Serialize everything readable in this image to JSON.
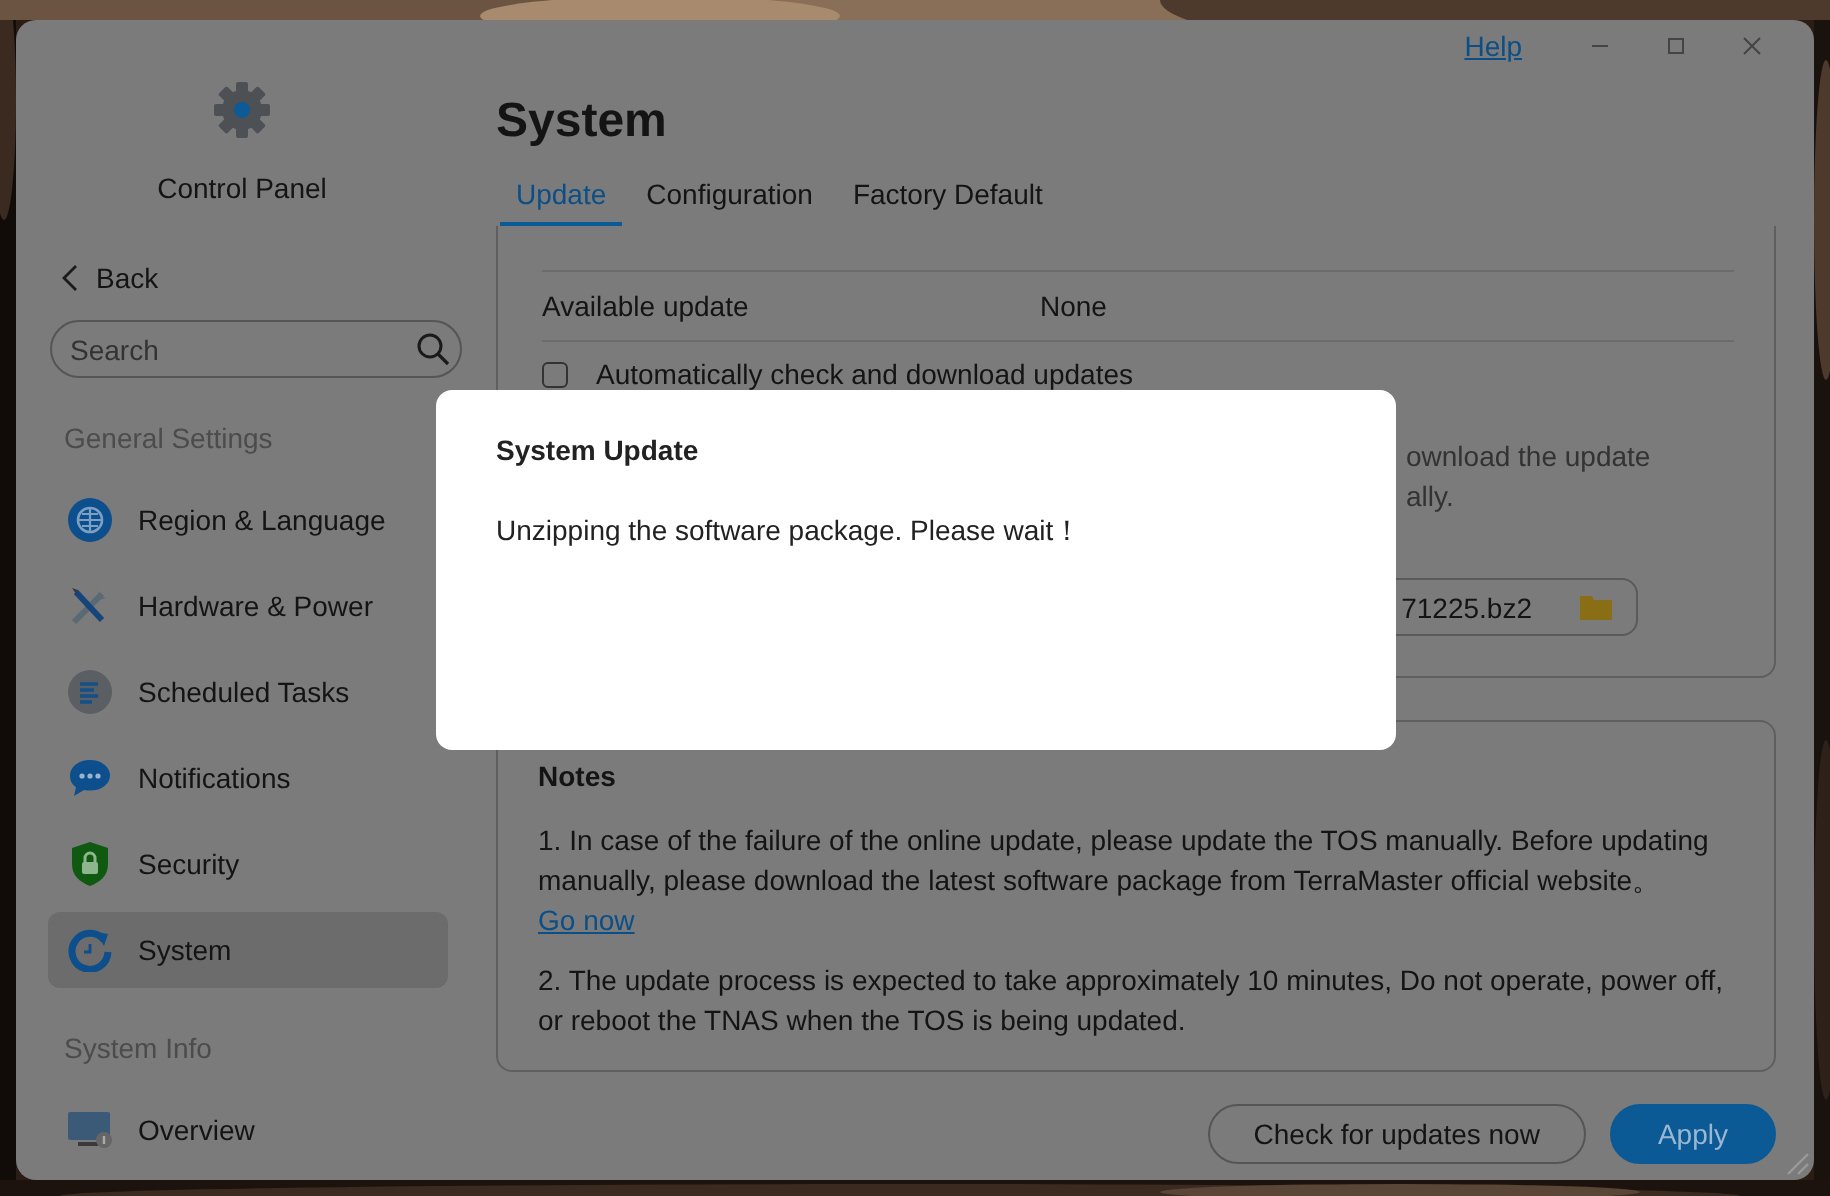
{
  "window": {
    "help": "Help"
  },
  "sidebar": {
    "title": "Control Panel",
    "back": "Back",
    "search": {
      "placeholder": "Search"
    },
    "sections": [
      {
        "heading": "General Settings",
        "items": [
          {
            "label": "Region & Language",
            "kind": "globe",
            "selected": false
          },
          {
            "label": "Hardware & Power",
            "kind": "tools",
            "selected": false
          },
          {
            "label": "Scheduled Tasks",
            "kind": "list",
            "selected": false
          },
          {
            "label": "Notifications",
            "kind": "chat",
            "selected": false
          },
          {
            "label": "Security",
            "kind": "shield",
            "selected": false
          },
          {
            "label": "System",
            "kind": "cycle",
            "selected": true
          }
        ]
      },
      {
        "heading": "System Info",
        "items": [
          {
            "label": "Overview",
            "kind": "monitor",
            "selected": false
          }
        ]
      }
    ]
  },
  "page": {
    "title": "System",
    "tabs": [
      {
        "label": "Update",
        "selected": true
      },
      {
        "label": "Configuration",
        "selected": false
      },
      {
        "label": "Factory Default",
        "selected": false
      }
    ],
    "available_update": {
      "label": "Available update",
      "value": "None"
    },
    "auto_update": {
      "label": "Automatically check and download updates",
      "checked": false
    },
    "hint_fragments": [
      "ownload the update",
      "ally."
    ],
    "file_field": {
      "value": "71225.bz2"
    },
    "notes": {
      "heading": "Notes",
      "items": [
        {
          "text": "1. In case of the failure of the online update, please update the TOS manually. Before updating manually, please download the latest software package from TerraMaster official website。",
          "link": "Go now"
        },
        {
          "text": "2. The update process is expected to take approximately 10 minutes, Do not operate, power off, or reboot the TNAS when the TOS is being updated."
        }
      ]
    },
    "buttons": [
      {
        "label": "Check for updates now",
        "kind": "secondary"
      },
      {
        "label": "Apply",
        "kind": "primary"
      }
    ]
  },
  "dialog": {
    "title": "System Update",
    "message": "Unzipping the software package. Please wait！"
  }
}
